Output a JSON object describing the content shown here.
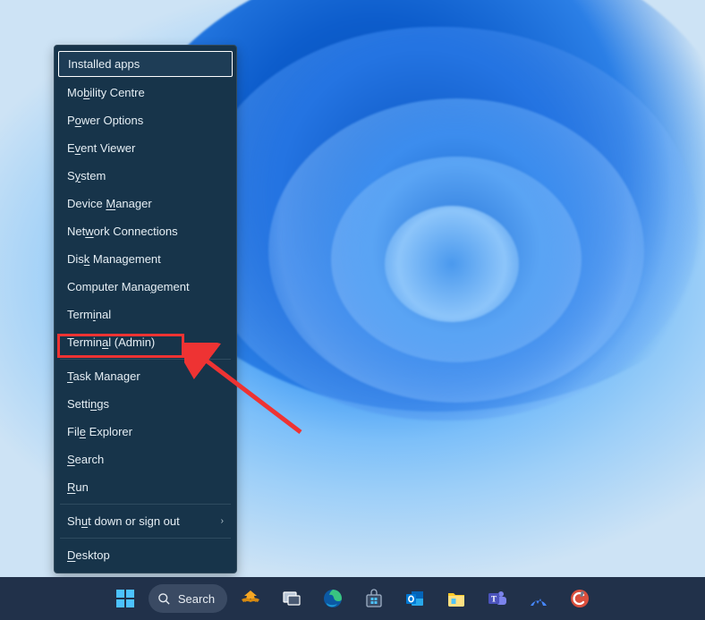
{
  "menu": {
    "items": [
      {
        "label": "Installed apps",
        "underline": null
      },
      {
        "label": "Mobility Centre",
        "underline": "B"
      },
      {
        "label": "Power Options",
        "underline": "O"
      },
      {
        "label": "Event Viewer",
        "underline": "V"
      },
      {
        "label": "System",
        "underline": "Y"
      },
      {
        "label": "Device Manager",
        "underline": "M"
      },
      {
        "label": "Network Connections",
        "underline": "W"
      },
      {
        "label": "Disk Management",
        "underline": "K"
      },
      {
        "label": "Computer Management",
        "underline": "G"
      },
      {
        "label": "Terminal",
        "underline": "I"
      },
      {
        "label": "Terminal (Admin)",
        "underline": "A"
      },
      {
        "label": "Task Manager",
        "underline": "T"
      },
      {
        "label": "Settings",
        "underline": "N"
      },
      {
        "label": "File Explorer",
        "underline": "E"
      },
      {
        "label": "Search",
        "underline": "S"
      },
      {
        "label": "Run",
        "underline": "R"
      },
      {
        "label": "Shut down or sign out",
        "underline": "U",
        "submenu": true
      },
      {
        "label": "Desktop",
        "underline": "D"
      }
    ],
    "highlighted_index": 0,
    "red_box_index": 10,
    "separators_after": [
      10,
      15,
      16
    ]
  },
  "taskbar": {
    "search_label": "Search",
    "icons": [
      {
        "name": "start",
        "color": "#4cc2ff"
      },
      {
        "name": "search"
      },
      {
        "name": "phoenix",
        "color": "#f5a623"
      },
      {
        "name": "task-view",
        "color": "#ffffff"
      },
      {
        "name": "edge",
        "color": "#29a6d8"
      },
      {
        "name": "store",
        "color": "#ffffff"
      },
      {
        "name": "outlook",
        "color": "#0078d4"
      },
      {
        "name": "file-explorer",
        "color": "#ffca28"
      },
      {
        "name": "teams",
        "color": "#5059c9"
      },
      {
        "name": "nord",
        "color": "#4687ff"
      },
      {
        "name": "ccleaner",
        "color": "#d94f3d"
      }
    ]
  }
}
